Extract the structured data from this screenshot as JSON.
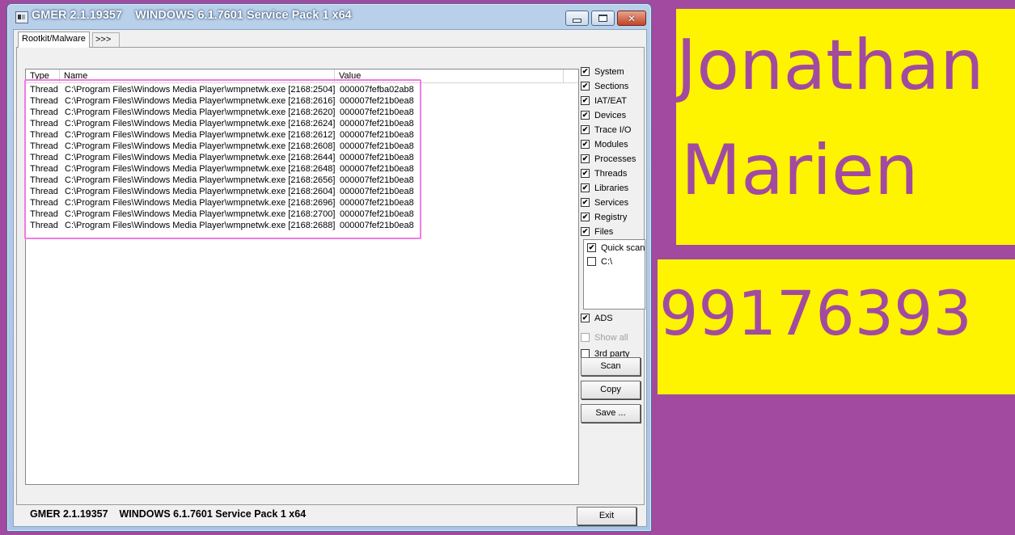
{
  "window": {
    "title": "GMER 2.1.19357    WINDOWS 6.1.7601 Service Pack 1 x64",
    "minimize_icon": "minimize-icon",
    "maximize_icon": "maximize-icon",
    "close_glyph": "✕"
  },
  "tabs": [
    {
      "label": "Rootkit/Malware",
      "active": true
    },
    {
      "label": ">>>",
      "active": false
    }
  ],
  "list": {
    "columns": [
      "Type",
      "Name",
      "Value"
    ],
    "rows": [
      {
        "type": "Thread",
        "name": "C:\\Program Files\\Windows Media Player\\wmpnetwk.exe [2168:2504]",
        "value": "000007fefba02ab8"
      },
      {
        "type": "Thread",
        "name": "C:\\Program Files\\Windows Media Player\\wmpnetwk.exe [2168:2616]",
        "value": "000007fef21b0ea8"
      },
      {
        "type": "Thread",
        "name": "C:\\Program Files\\Windows Media Player\\wmpnetwk.exe [2168:2620]",
        "value": "000007fef21b0ea8"
      },
      {
        "type": "Thread",
        "name": "C:\\Program Files\\Windows Media Player\\wmpnetwk.exe [2168:2624]",
        "value": "000007fef21b0ea8"
      },
      {
        "type": "Thread",
        "name": "C:\\Program Files\\Windows Media Player\\wmpnetwk.exe [2168:2612]",
        "value": "000007fef21b0ea8"
      },
      {
        "type": "Thread",
        "name": "C:\\Program Files\\Windows Media Player\\wmpnetwk.exe [2168:2608]",
        "value": "000007fef21b0ea8"
      },
      {
        "type": "Thread",
        "name": "C:\\Program Files\\Windows Media Player\\wmpnetwk.exe [2168:2644]",
        "value": "000007fef21b0ea8"
      },
      {
        "type": "Thread",
        "name": "C:\\Program Files\\Windows Media Player\\wmpnetwk.exe [2168:2648]",
        "value": "000007fef21b0ea8"
      },
      {
        "type": "Thread",
        "name": "C:\\Program Files\\Windows Media Player\\wmpnetwk.exe [2168:2656]",
        "value": "000007fef21b0ea8"
      },
      {
        "type": "Thread",
        "name": "C:\\Program Files\\Windows Media Player\\wmpnetwk.exe [2168:2604]",
        "value": "000007fef21b0ea8"
      },
      {
        "type": "Thread",
        "name": "C:\\Program Files\\Windows Media Player\\wmpnetwk.exe [2168:2696]",
        "value": "000007fef21b0ea8"
      },
      {
        "type": "Thread",
        "name": "C:\\Program Files\\Windows Media Player\\wmpnetwk.exe [2168:2700]",
        "value": "000007fef21b0ea8"
      },
      {
        "type": "Thread",
        "name": "C:\\Program Files\\Windows Media Player\\wmpnetwk.exe [2168:2688]",
        "value": "000007fef21b0ea8"
      }
    ]
  },
  "options": [
    {
      "label": "System",
      "checked": true
    },
    {
      "label": "Sections",
      "checked": true
    },
    {
      "label": "IAT/EAT",
      "checked": true
    },
    {
      "label": "Devices",
      "checked": true
    },
    {
      "label": "Trace I/O",
      "checked": true
    },
    {
      "label": "Modules",
      "checked": true
    },
    {
      "label": "Processes",
      "checked": true
    },
    {
      "label": "Threads",
      "checked": true
    },
    {
      "label": "Libraries",
      "checked": true
    },
    {
      "label": "Services",
      "checked": true
    },
    {
      "label": "Registry",
      "checked": true
    },
    {
      "label": "Files",
      "checked": true
    }
  ],
  "drives": [
    {
      "label": "Quick scan",
      "checked": true
    },
    {
      "label": "C:\\",
      "checked": false
    }
  ],
  "extra_options": [
    {
      "label": "ADS",
      "checked": true,
      "enabled": true
    },
    {
      "label": "Show all",
      "checked": false,
      "enabled": false
    },
    {
      "label": "3rd party",
      "checked": false,
      "enabled": true
    }
  ],
  "buttons": {
    "scan": "Scan",
    "copy": "Copy",
    "save": "Save ...",
    "exit": "Exit"
  },
  "status": {
    "text": "GMER 2.1.19357    WINDOWS 6.1.7601 Service Pack 1 x64"
  },
  "overlay": {
    "first_name": "Jonathan",
    "last_name": "Marien",
    "number": "99176393"
  },
  "colors": {
    "background": "#a24aa0",
    "panel": "#fef400",
    "highlight": "#f07ce0"
  }
}
